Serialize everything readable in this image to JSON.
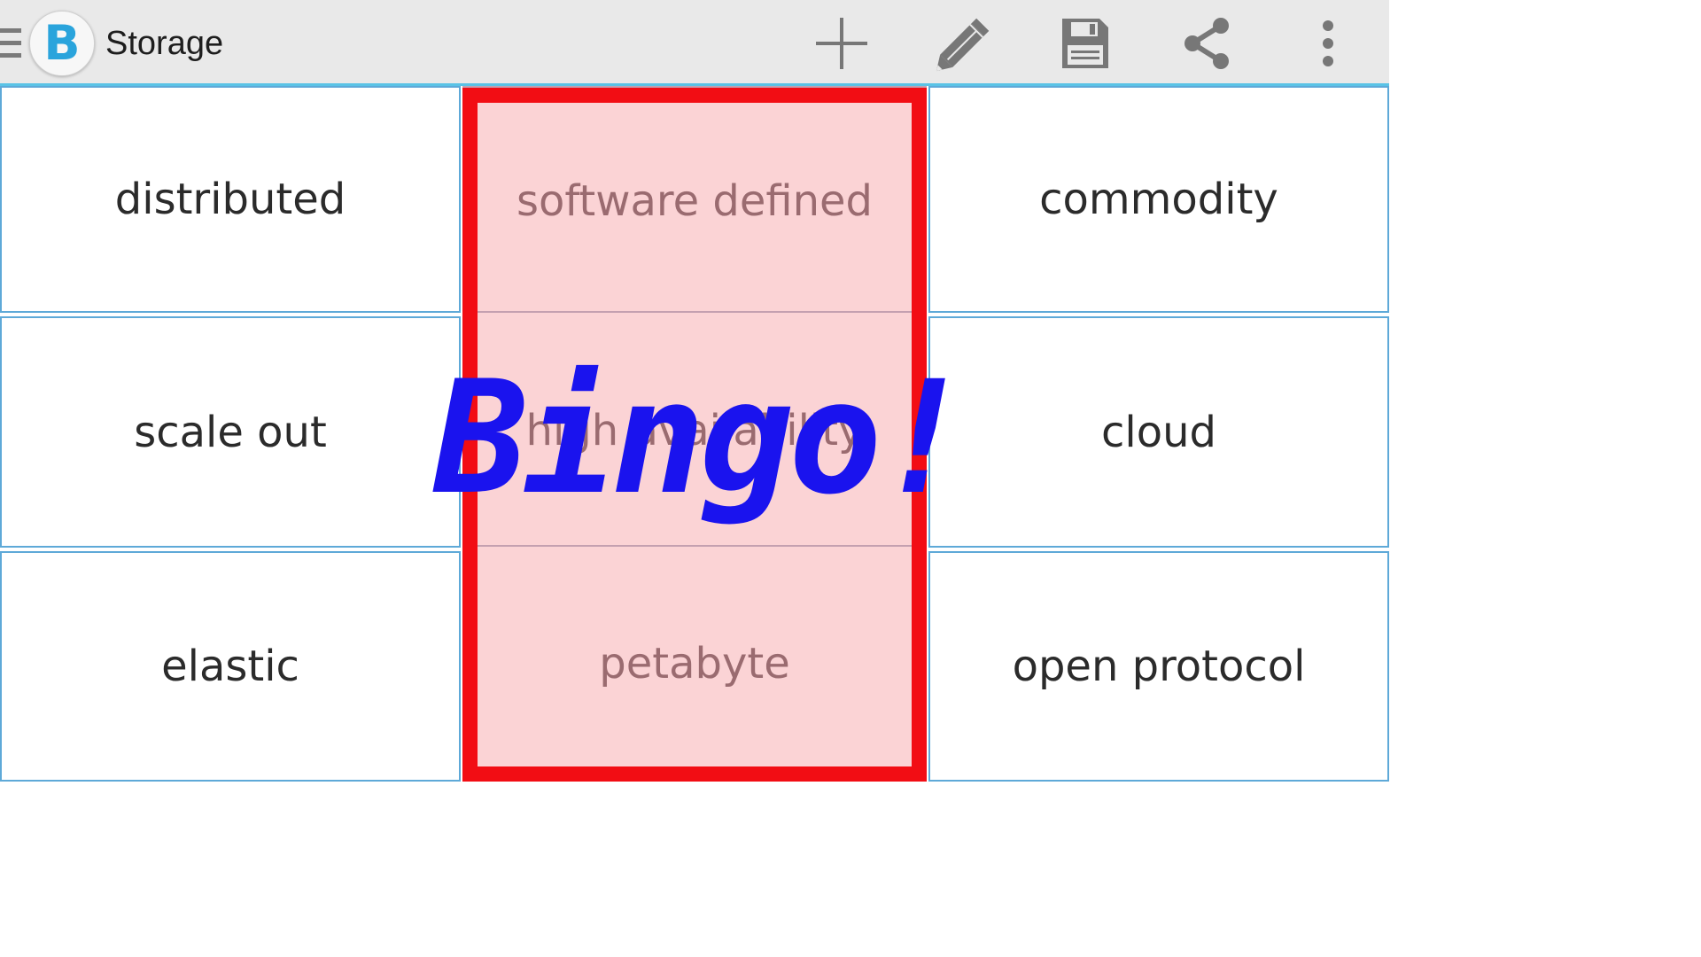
{
  "appbar": {
    "title": "Storage",
    "logo_letter": "B",
    "icons": [
      "menu-icon",
      "add-icon",
      "edit-icon",
      "save-icon",
      "share-icon",
      "more-vert-icon"
    ],
    "accent_color": "#5ac3e6"
  },
  "board": {
    "cells": [
      {
        "label": "distributed",
        "marked": false
      },
      {
        "label": "software defined",
        "marked": true
      },
      {
        "label": "commodity",
        "marked": false
      },
      {
        "label": "scale out",
        "marked": false
      },
      {
        "label": "high availability",
        "marked": true
      },
      {
        "label": "cloud",
        "marked": false
      },
      {
        "label": "elastic",
        "marked": false
      },
      {
        "label": "petabyte",
        "marked": true
      },
      {
        "label": "open protocol",
        "marked": false
      }
    ],
    "marked_color": "#fbd3d5",
    "highlight_color": "#f20d14"
  },
  "bingo": {
    "text": "Bingo!",
    "color": "#1a13ee"
  }
}
